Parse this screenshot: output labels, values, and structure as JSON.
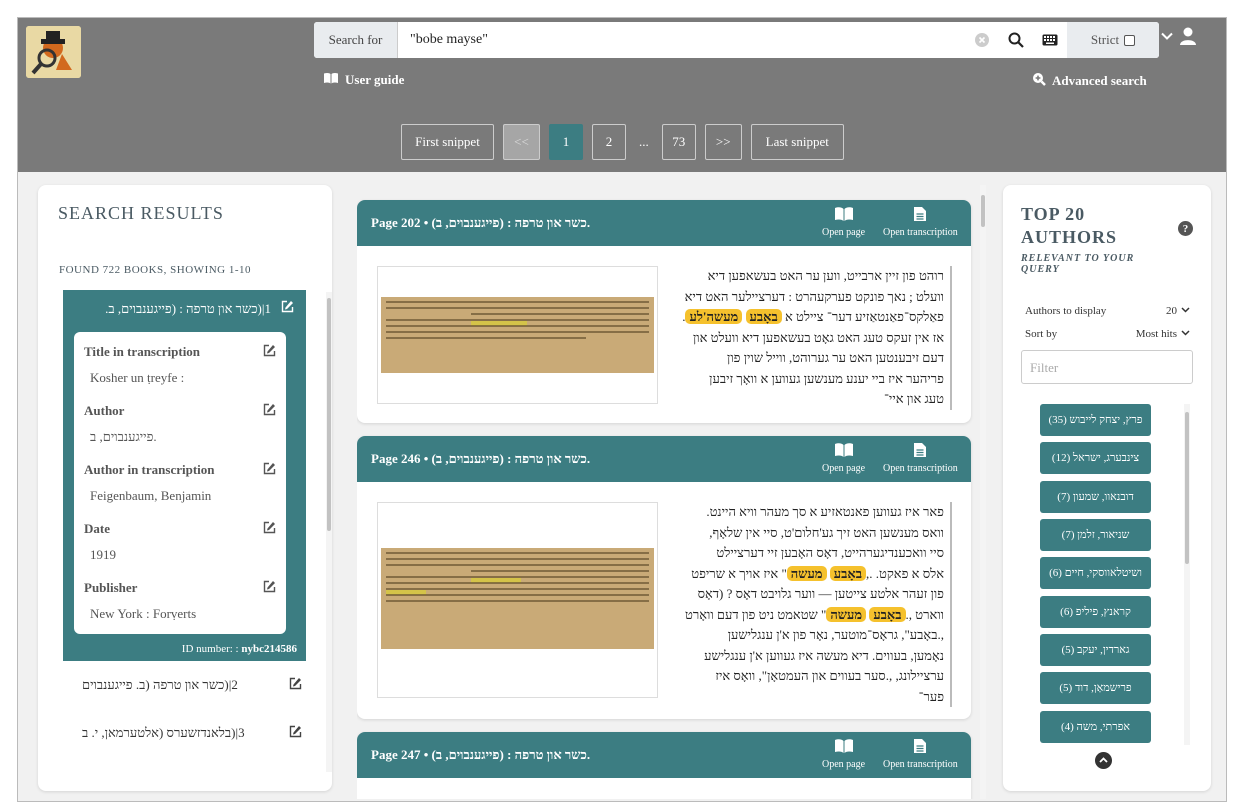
{
  "header": {
    "search_label": "Search for",
    "search_value": "\"bobe mayse\"",
    "strict_label": "Strict",
    "user_guide": "User guide",
    "advanced_search": "Advanced search"
  },
  "pager": {
    "first": "First snippet",
    "prev": "<<",
    "pages": [
      "1",
      "2"
    ],
    "ellipsis": "...",
    "last_page": "73",
    "next": ">>",
    "last": "Last snippet",
    "active_page": "1"
  },
  "results": {
    "heading": "SEARCH RESULTS",
    "found": "FOUND 722 BOOKS, SHOWING 1-10",
    "active": {
      "title": "1|(כשר און טרפה : (פייגענבוים, ב.",
      "fields": [
        {
          "label": "Title in transcription",
          "value": "Kosher un ṭreyfe :"
        },
        {
          "label": "Author",
          "value": "פייגענבוים, ב."
        },
        {
          "label": "Author in transcription",
          "value": "Feigenbaum, Benjamin"
        },
        {
          "label": "Date",
          "value": "1919"
        },
        {
          "label": "Publisher",
          "value": "New York : Forṿerts"
        }
      ],
      "id_label": "ID number: :",
      "id_value": "nybc214586"
    },
    "others": [
      {
        "title": "2|(כשר און טרפה (ב. פייגענבוים"
      },
      {
        "title": "3|(בלאנדזשערס (אלטערמאן, י. ב"
      }
    ]
  },
  "snippets": [
    {
      "title": "Page 202 • (כשר און טרפה : (פייגענבוים, ב.",
      "open_page": "Open page",
      "open_transcription": "Open transcription",
      "lines": [
        {
          "segments": [
            {
              "t": "רוהט פון זיין ארבייט, ווען ער האט בעשאפען דיא"
            }
          ]
        },
        {
          "segments": [
            {
              "t": "וועלט ; נאך פונקט פערקעהרט : דערציילער האט דיא"
            }
          ]
        },
        {
          "segments": [
            {
              "t": "פאַלקס־פאַנטאַזיע דער־ ציילט א "
            },
            {
              "t": "באָבע",
              "m": true
            },
            {
              "t": " "
            },
            {
              "t": "מעשה'לע",
              "m": true
            },
            {
              "t": "."
            }
          ]
        },
        {
          "segments": [
            {
              "t": "אז אין זעקס טעג האט גאָט בעשאפען דיא וועלט און"
            }
          ]
        },
        {
          "segments": [
            {
              "t": "דעם זיבענטען האט ער גערוהט, ווייל שוין פון"
            }
          ]
        },
        {
          "segments": [
            {
              "t": "פריהער איז ביי יענע מענשען געווען א וואָך זיבען"
            }
          ]
        },
        {
          "segments": [
            {
              "t": "טעג און איי־"
            }
          ]
        }
      ]
    },
    {
      "title": "Page 246 • (כשר און טרפה : (פייגענבוים, ב.",
      "open_page": "Open page",
      "open_transcription": "Open transcription",
      "lines": [
        {
          "segments": [
            {
              "t": "פאר איז געווען פאנטאזיע א סך מעהר וויא היינט."
            }
          ]
        },
        {
          "segments": [
            {
              "t": "וואס מענשען האט זיך גע'חלום'ט, סיי אין שלאָף,"
            }
          ]
        },
        {
          "segments": [
            {
              "t": "סיי וואכענדיגערהייט, דאָס האָבען זיי דערציילט"
            }
          ]
        },
        {
          "segments": [
            {
              "t": "אלס א פאקט. .,"
            },
            {
              "t": "באָבע",
              "m": true
            },
            {
              "t": " "
            },
            {
              "t": "מעשה",
              "m": true
            },
            {
              "t": "\" איז אויך א שריפט"
            }
          ]
        },
        {
          "segments": [
            {
              "t": "פון זעהר אלטע צייטען — ווער גלויבט דאָס ? (דאָס"
            }
          ]
        },
        {
          "segments": [
            {
              "t": "ווארט ,."
            },
            {
              "t": "באָבע",
              "m": true
            },
            {
              "t": " "
            },
            {
              "t": "מעשה",
              "m": true
            },
            {
              "t": "\" שטאמט ניט פון דעם וואָרט"
            }
          ]
        },
        {
          "segments": [
            {
              "t": ",.באָבע\", גראָס־מוטער, נאָר פון א'ן ענגלישען"
            }
          ]
        },
        {
          "segments": [
            {
              "t": "נאָמען, בעווים. דיא מעשה איז געווען א'ן ענגלישע"
            }
          ]
        },
        {
          "segments": [
            {
              "t": "ערציילונג, ,.סער בעווים און העמטאָן\", וואָס איז"
            }
          ]
        },
        {
          "segments": [
            {
              "t": "פער־"
            }
          ]
        }
      ]
    },
    {
      "title": "Page 247 • (כשר און טרפה : (פייגענבוים, ב.",
      "open_page": "Open page",
      "open_transcription": "Open transcription",
      "lines": []
    }
  ],
  "authors_panel": {
    "heading": "TOP 20 AUTHORS",
    "subheading": "RELEVANT TO YOUR QUERY",
    "display_label": "Authors to display",
    "display_value": "20",
    "sort_label": "Sort by",
    "sort_value": "Most hits",
    "filter_placeholder": "Filter",
    "authors": [
      "פרץ, יצחק לייבוש (35)",
      "צינבערג, ישראל (12)",
      "דובנאוו, שמעון (7)",
      "שניאור, זלמן (7)",
      "ושיטלאווסקי, חיים (6)",
      "קראנץ, פיליפ (6)",
      "גארדין, יעקב (5)",
      "פרישמאַן, דוד (5)",
      "אפרתי, משה (4)"
    ]
  }
}
